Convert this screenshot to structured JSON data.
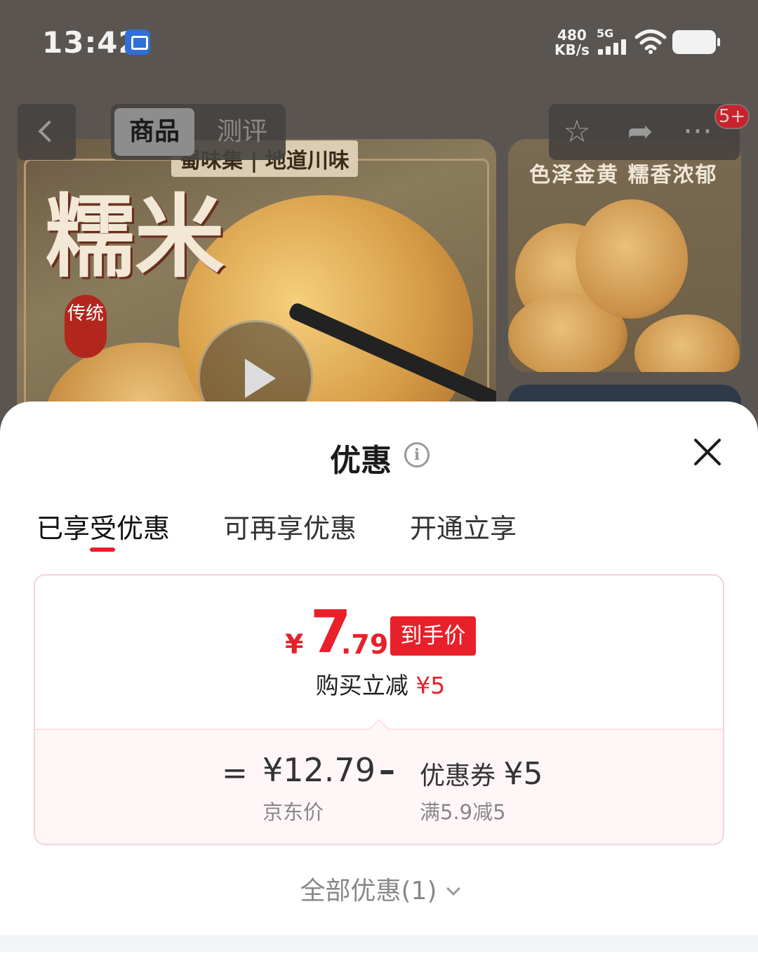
{
  "status_bar": {
    "time": "13:42",
    "net_speed_value": "480",
    "net_speed_unit": "KB/s",
    "network": "5G"
  },
  "background": {
    "nav_tabs": [
      "商品",
      "测评"
    ],
    "cart_badge": "5+",
    "main_image_banner": "蜀味集 | 地道川味",
    "main_image_title": "糯米",
    "main_image_seal": "传统",
    "side_image_caption": "色泽金黄 糯香浓郁"
  },
  "sheet": {
    "title": "优惠",
    "tabs": [
      "已享受优惠",
      "可再享优惠",
      "开通立享"
    ],
    "active_tab_index": 0,
    "final_price": {
      "currency": "¥",
      "integer": "7",
      "decimal": ".79",
      "tag": "到手价"
    },
    "instant_discount": {
      "label": "购买立减",
      "amount": "¥5"
    },
    "breakdown": {
      "equals": "=",
      "jd_price": "¥12.79",
      "jd_price_label": "京东价",
      "minus": "–",
      "coupon_label": "优惠券",
      "coupon_amount": "¥5",
      "coupon_condition": "满5.9减5"
    },
    "all_offers": "全部优惠(1)"
  },
  "colors": {
    "accent_red": "#e8202a",
    "card_border": "#f7d2da",
    "breakdown_bg": "#fff6f7"
  }
}
